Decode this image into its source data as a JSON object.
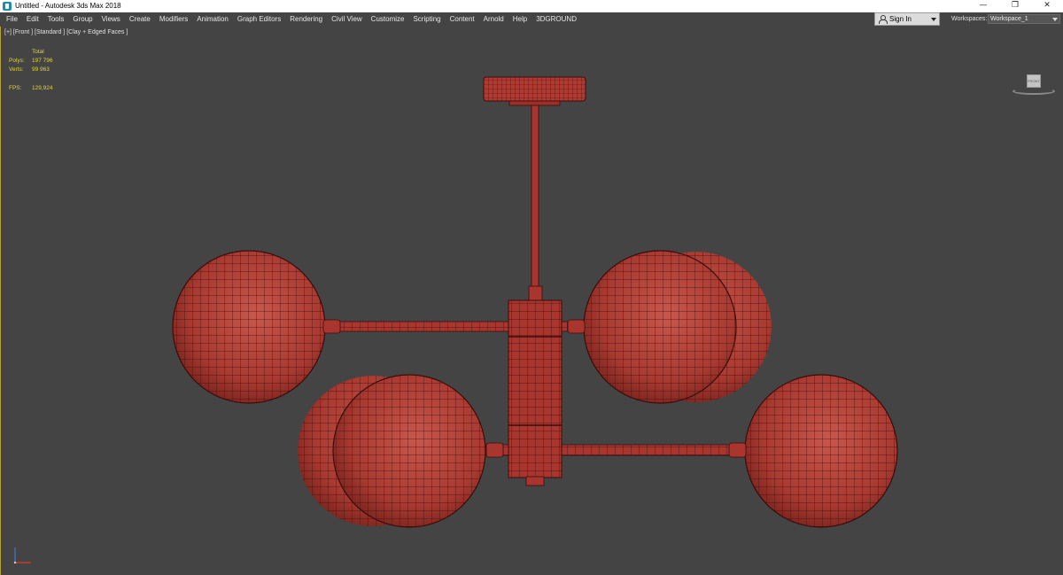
{
  "window": {
    "title": "Untitled - Autodesk 3ds Max 2018",
    "minimize": "—",
    "restore": "❐",
    "close": "✕"
  },
  "menu": [
    "File",
    "Edit",
    "Tools",
    "Group",
    "Views",
    "Create",
    "Modifiers",
    "Animation",
    "Graph Editors",
    "Rendering",
    "Civil View",
    "Customize",
    "Scripting",
    "Content",
    "Arnold",
    "Help",
    "3DGROUND"
  ],
  "signin": {
    "label": "Sign In"
  },
  "workspace": {
    "label": "Workspaces:",
    "value": "Workspace_1"
  },
  "viewport": {
    "label": "[+] [Front ] [Standard ] [Clay + Edged Faces ]",
    "stats": {
      "total_label": "Total",
      "polys_label": "Polys:",
      "polys_value": "197 796",
      "verts_label": "Verts:",
      "verts_value": "99 963",
      "fps_label": "FPS:",
      "fps_value": "129,924"
    },
    "viewcube_face": "FRONT"
  },
  "colors": {
    "viewport_bg": "#444444",
    "model_red": "#b03a32",
    "wire": "#3a0d0a",
    "stats_yellow": "#e3d33c"
  },
  "icons": {
    "app": "3ds-max-icon",
    "user": "user-icon",
    "viewcube": "viewcube-icon",
    "axis": "axis-tripod-icon"
  }
}
